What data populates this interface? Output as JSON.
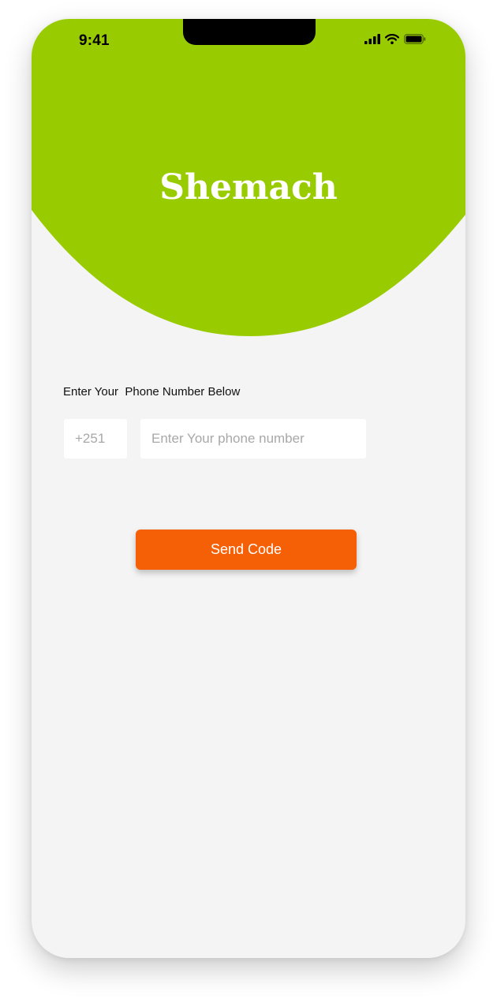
{
  "status_bar": {
    "time": "9:41",
    "icons": [
      "signal-icon",
      "wifi-icon",
      "battery-icon"
    ]
  },
  "header": {
    "brand": "Shemach",
    "color": "#99cc00"
  },
  "form": {
    "prompt": "Enter Your  Phone Number Below",
    "country_code": "+251",
    "phone_value": "",
    "phone_placeholder": "Enter Your phone number",
    "submit_label": "Send Code",
    "submit_color": "#f55f05"
  },
  "colors": {
    "background": "#f4f4f4",
    "accent": "#99cc00",
    "button": "#f55f05"
  }
}
